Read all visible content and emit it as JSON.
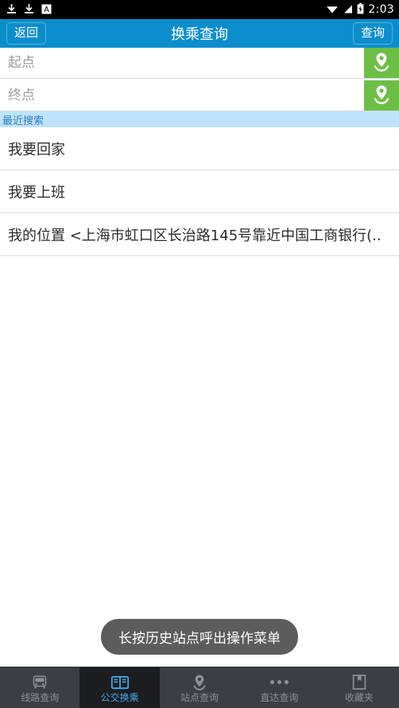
{
  "statusbar": {
    "icons": [
      "download-icon",
      "download-icon",
      "app-badge-icon",
      "wifi-icon",
      "cellular-signal-icon",
      "battery-charging-icon"
    ],
    "time": "2:03"
  },
  "titlebar": {
    "back_label": "返回",
    "title": "换乘查询",
    "search_label": "查询",
    "background": "#0c8ecc"
  },
  "form": {
    "start": {
      "value": "",
      "placeholder": "起点",
      "locate_icon": "map-pin-icon"
    },
    "end": {
      "value": "",
      "placeholder": "终点",
      "locate_icon": "map-pin-icon"
    },
    "locate_button_color": "#6cbe45"
  },
  "recent": {
    "header": "最近搜索",
    "header_background": "#bfe3fa",
    "items": [
      {
        "label": "我要回家"
      },
      {
        "label": "我要上班"
      },
      {
        "label": "我的位置 <上海市虹口区长治路145号靠近中国工商银行(.."
      }
    ]
  },
  "toast": {
    "message": "长按历史站点呼出操作菜单"
  },
  "bottomnav": {
    "active_color": "#4aa8e8",
    "items": [
      {
        "label": "线路查询",
        "icon": "bus-icon",
        "active": false
      },
      {
        "label": "公交换乘",
        "icon": "open-book-icon",
        "active": true
      },
      {
        "label": "站点查询",
        "icon": "map-pin-icon",
        "active": false
      },
      {
        "label": "直达查询",
        "icon": "three-dots-icon",
        "active": false
      },
      {
        "label": "收藏夹",
        "icon": "bookmark-box-icon",
        "active": false
      }
    ]
  }
}
